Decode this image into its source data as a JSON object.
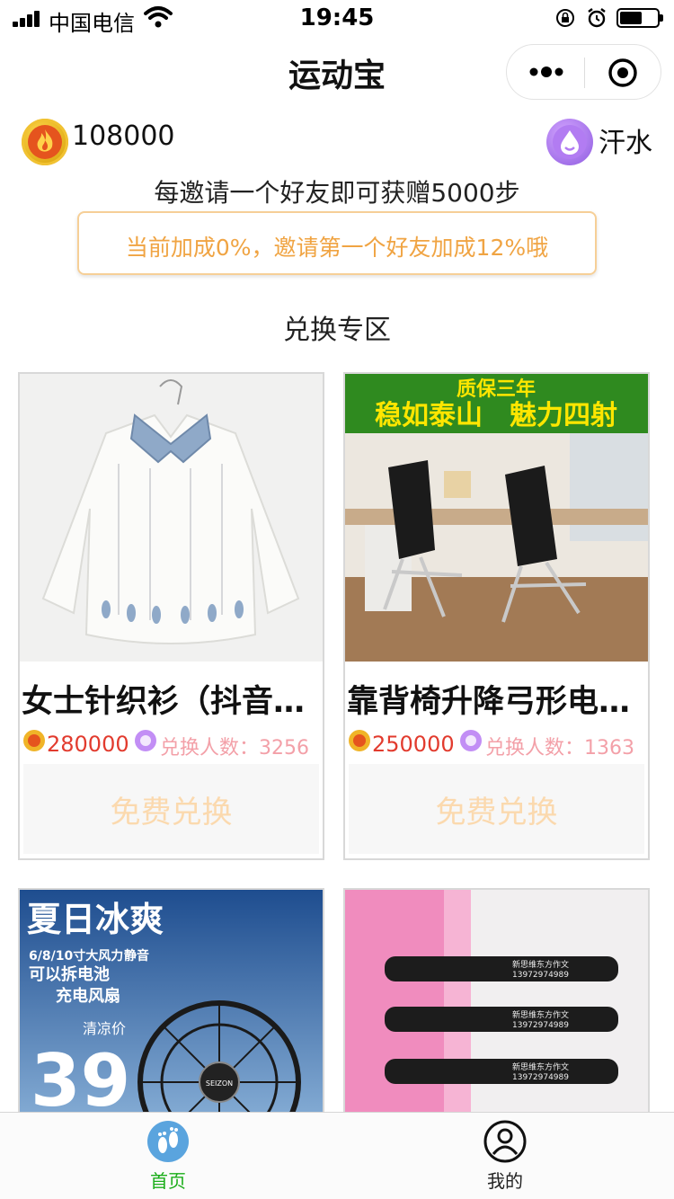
{
  "status_bar": {
    "carrier": "中国电信",
    "time": "19:45"
  },
  "nav": {
    "title": "运动宝"
  },
  "stats": {
    "steps_value": "108000",
    "sweat_label": "汗水"
  },
  "invite": {
    "text": "每邀请一个好友即可获赠5000步",
    "bonus": "当前加成0%，邀请第一个好友加成12%哦"
  },
  "section": {
    "title": "兑换专区"
  },
  "products": [
    {
      "name": "女士针织衫（抖音同款）",
      "price": "280000",
      "count_label": "兑换人数：",
      "count": "3256",
      "button": "免费兑换"
    },
    {
      "name": "靠背椅升降弓形电脑椅",
      "price": "250000",
      "count_label": "兑换人数：",
      "count": "1363",
      "button": "免费兑换",
      "banner_top": "质保三年",
      "banner_bottom": "稳如泰山　魅力四射"
    },
    {
      "name": "",
      "image_texts": {
        "headline": "夏日冰爽",
        "line1": "6/8/10寸大风力",
        "line1b": "静音",
        "line2": "可以拆电池",
        "line3": "充电风扇",
        "promo": "清凉价",
        "price": "39",
        "brand": "SEIZON"
      }
    },
    {
      "name": "",
      "image_texts": {
        "pen_text": "新思维东方作文",
        "pen_phone": "13972974989"
      }
    }
  ],
  "tabbar": {
    "home_label": "首页",
    "mine_label": "我的"
  },
  "colors": {
    "accent_green": "#1aad19",
    "price_red": "#e23b2e",
    "bonus_orange": "#f0a443"
  }
}
